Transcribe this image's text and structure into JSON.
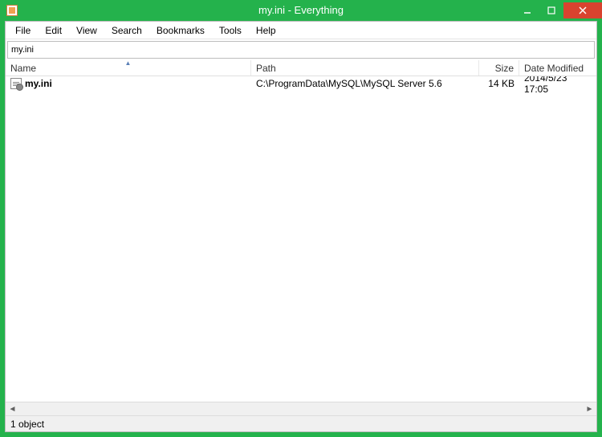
{
  "window": {
    "title": "my.ini - Everything"
  },
  "menu": {
    "file": "File",
    "edit": "Edit",
    "view": "View",
    "search": "Search",
    "bookmarks": "Bookmarks",
    "tools": "Tools",
    "help": "Help"
  },
  "search": {
    "value": "my.ini"
  },
  "columns": {
    "name": "Name",
    "path": "Path",
    "size": "Size",
    "date": "Date Modified"
  },
  "rows": [
    {
      "name": "my.ini",
      "path": "C:\\ProgramData\\MySQL\\MySQL Server 5.6",
      "size": "14 KB",
      "date": "2014/5/23 17:05"
    }
  ],
  "status": {
    "text": "1 object"
  }
}
